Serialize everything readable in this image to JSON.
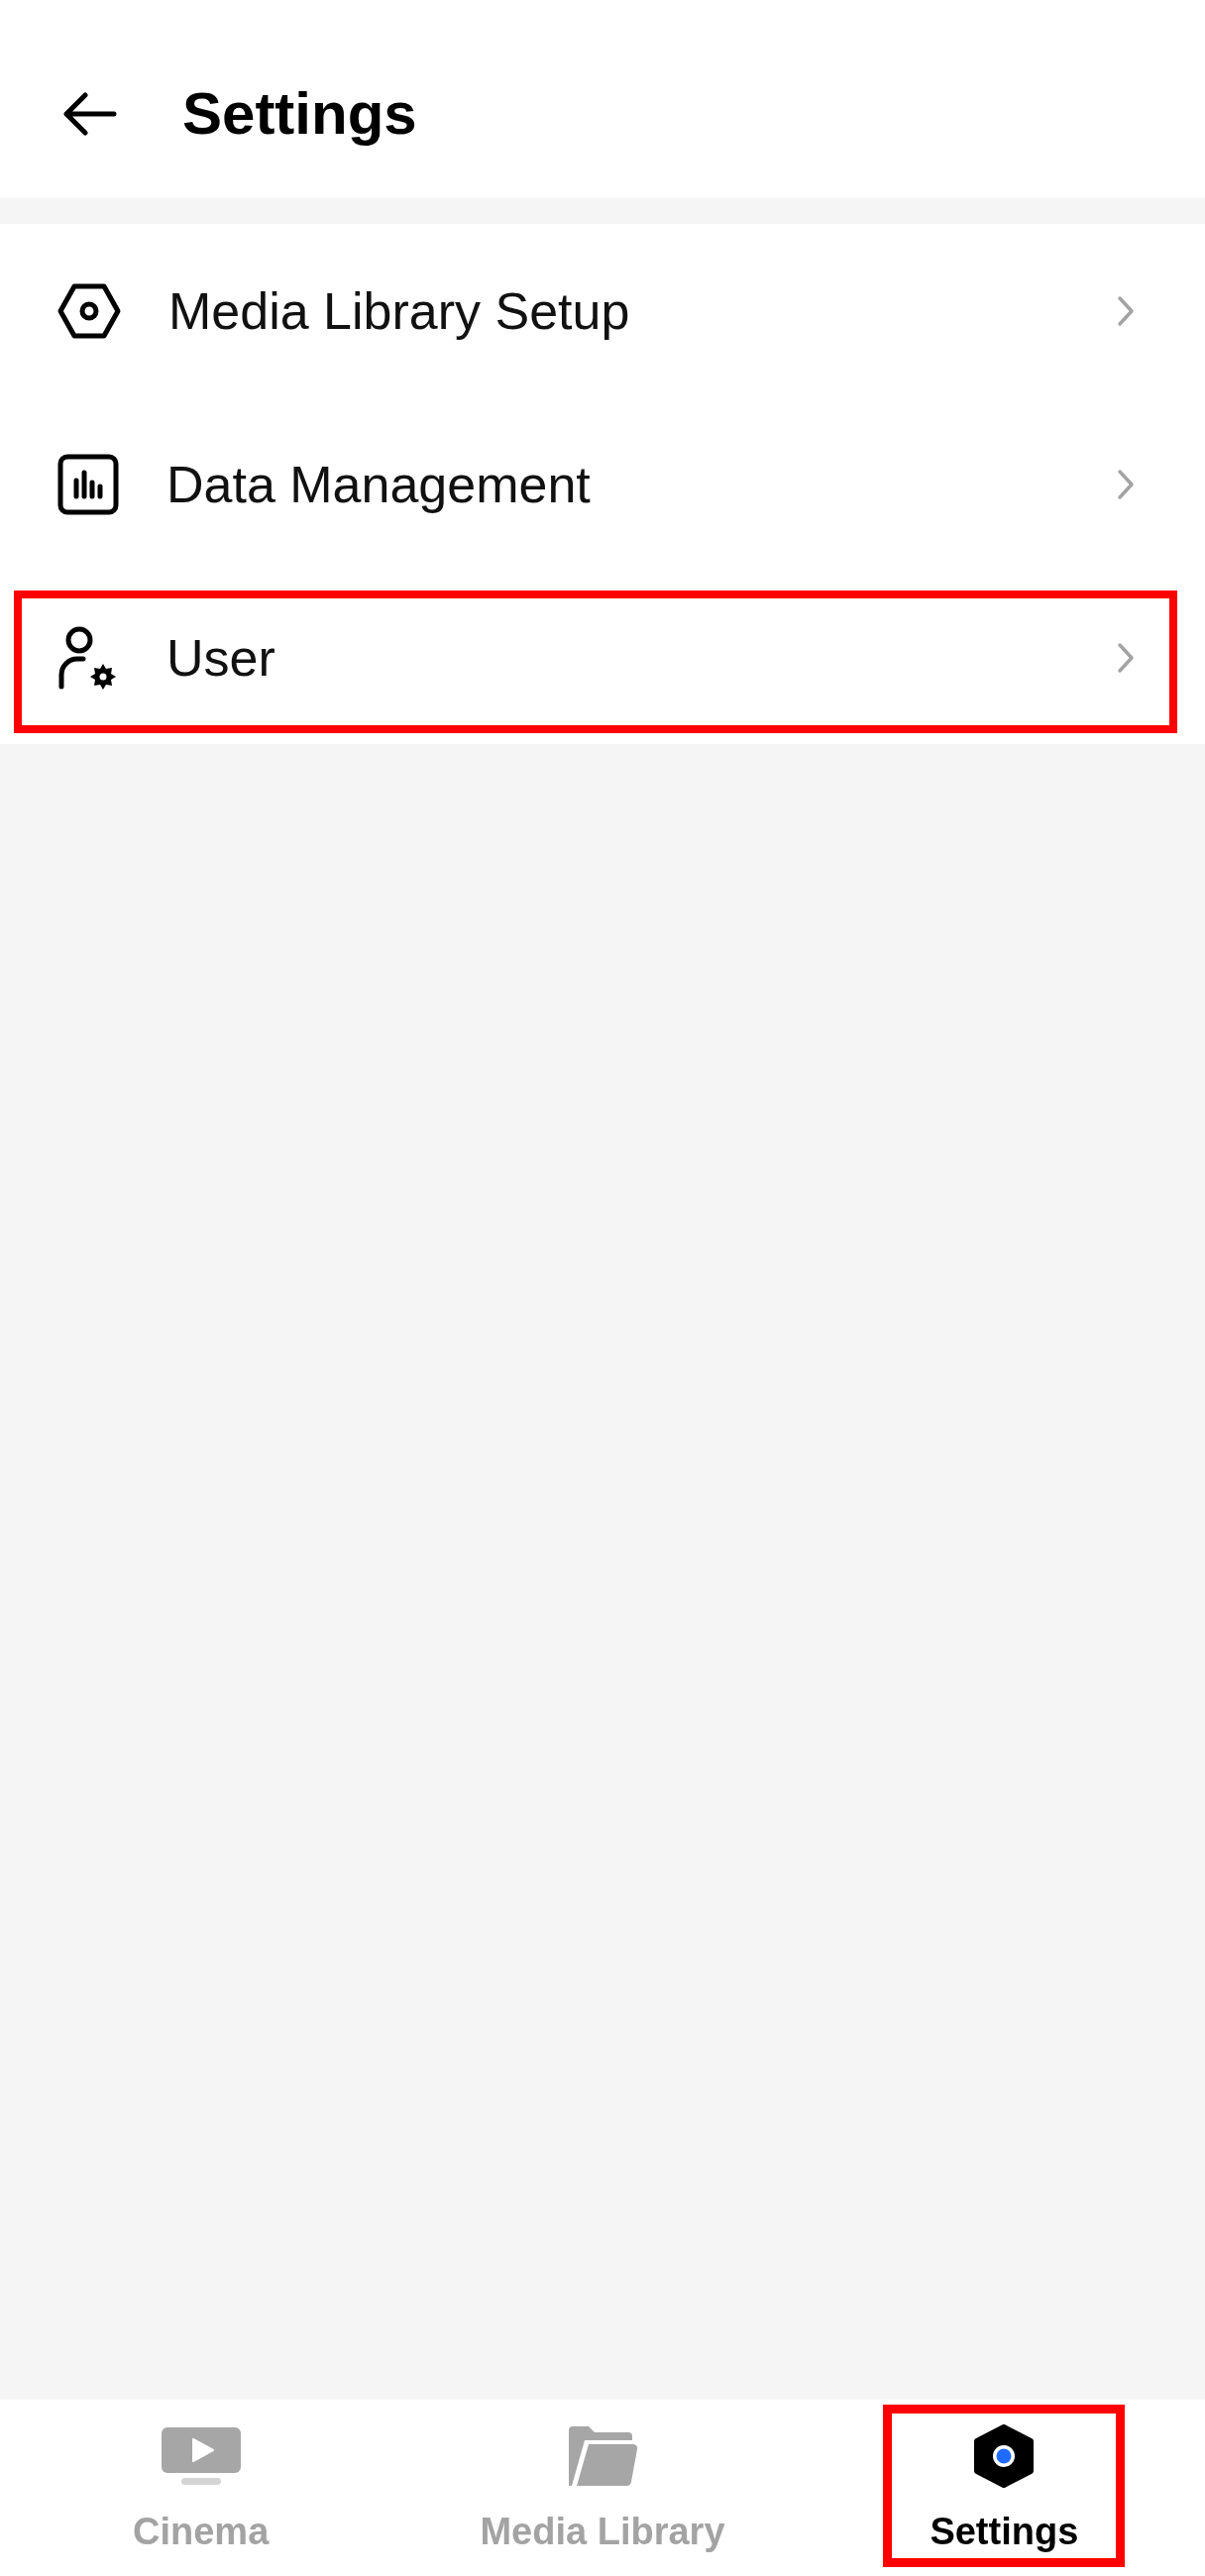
{
  "header": {
    "title": "Settings"
  },
  "menu": [
    {
      "label": "Media Library Setup",
      "highlighted": false
    },
    {
      "label": "Data Management",
      "highlighted": false
    },
    {
      "label": "User",
      "highlighted": true
    }
  ],
  "tab_bar": [
    {
      "label": "Cinema",
      "selected": false,
      "highlighted": false
    },
    {
      "label": "Media Library",
      "selected": false,
      "highlighted": false
    },
    {
      "label": "Settings",
      "selected": true,
      "highlighted": true
    }
  ]
}
